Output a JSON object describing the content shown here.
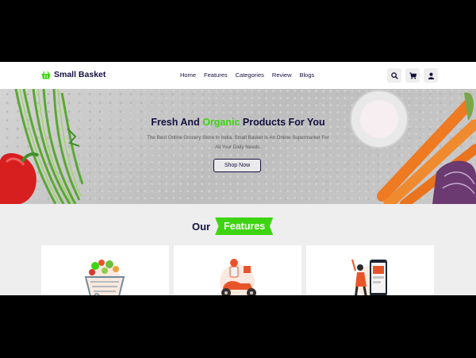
{
  "brand": {
    "name": "Small Basket"
  },
  "nav": {
    "items": [
      "Home",
      "Features",
      "Categories",
      "Review",
      "Blogs"
    ]
  },
  "header_icons": [
    "search-icon",
    "cart-icon",
    "user-icon"
  ],
  "hero": {
    "title_pre": "Fresh And ",
    "title_accent": "Organic",
    "title_post": " Products For You",
    "subtitle": "The Best Online Grocery Store In India. Small Basket Is An Online Supermarket For All Your Daily Needs.",
    "button_label": "Shop Now"
  },
  "features": {
    "heading_plain": "Our",
    "heading_tag": "Features"
  },
  "colors": {
    "accent": "#3dd511",
    "dark": "#130f40",
    "bg": "#eeeeee",
    "card_orange": "#e8542a"
  }
}
